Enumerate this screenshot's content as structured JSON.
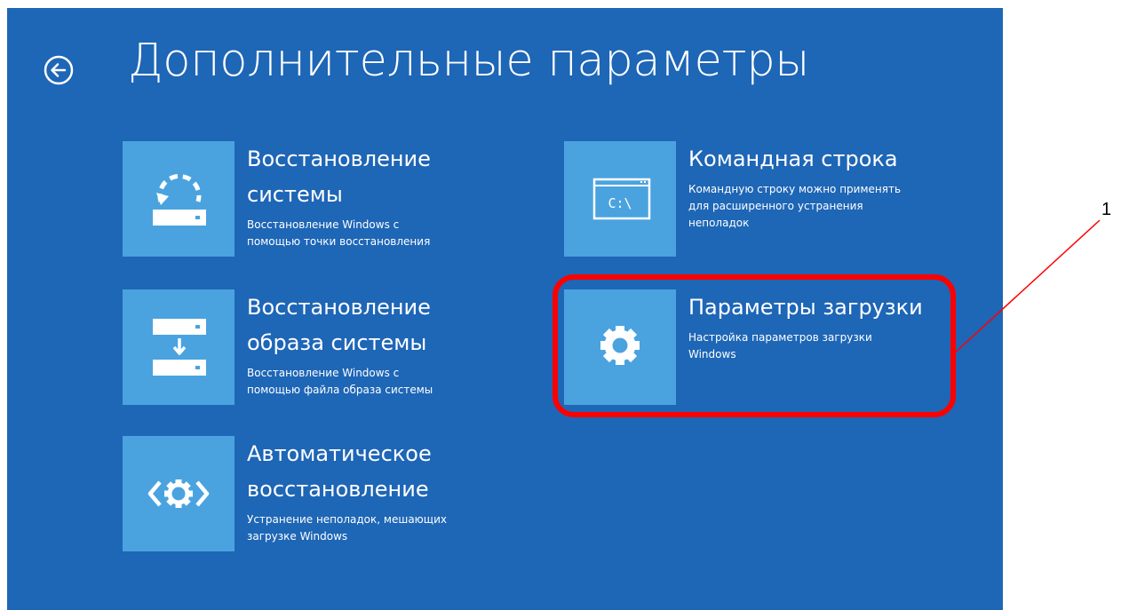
{
  "header": {
    "title": "Дополнительные параметры",
    "back_icon": "arrow-left-circle-icon"
  },
  "tiles": [
    {
      "title_line1": "Восстановление",
      "title_line2": "системы",
      "desc_line1": "Восстановление Windows с",
      "desc_line2": "помощью точки восстановления",
      "icon": "system-restore-icon"
    },
    {
      "title_line1": "Восстановление",
      "title_line2": "образа системы",
      "desc_line1": "Восстановление Windows с",
      "desc_line2": "помощью файла образа системы",
      "icon": "image-restore-icon"
    },
    {
      "title_line1": "Автоматическое",
      "title_line2": "восстановление",
      "desc_line1": "Устранение неполадок, мешающих",
      "desc_line2": "загрузке Windows",
      "icon": "automatic-repair-icon"
    },
    {
      "title_line1": "Командная строка",
      "desc_line1": "Командную строку можно применять",
      "desc_line2": "для расширенного устранения",
      "desc_line3": "неполадок",
      "icon": "command-prompt-icon",
      "icon_text": "C:\\"
    },
    {
      "title_line1": "Параметры загрузки",
      "desc_line1": "Настройка параметров загрузки",
      "desc_line2": "Windows",
      "icon": "gear-icon"
    }
  ],
  "annotation": {
    "label": "1"
  },
  "colors": {
    "background": "#1e66b6",
    "tile": "#4aa3df",
    "highlight": "#ff0000"
  }
}
